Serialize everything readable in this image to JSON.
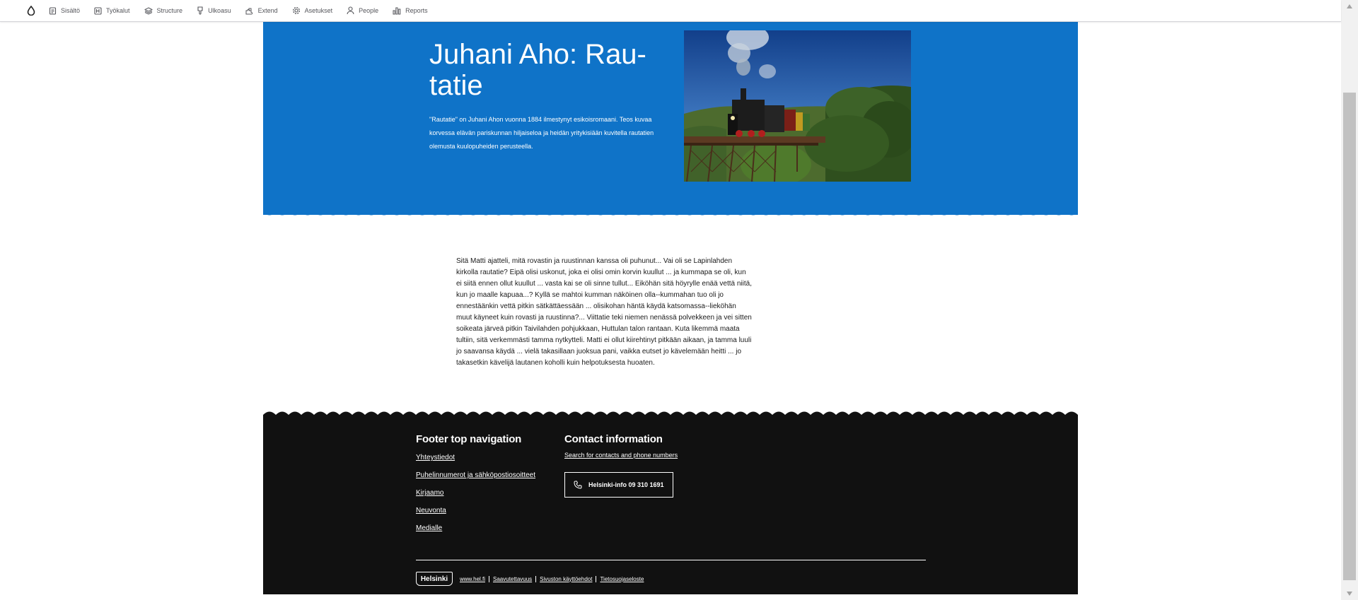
{
  "toolbar": {
    "home_icon": "drop-icon",
    "items": [
      {
        "label": "Sisältö",
        "icon": "document-icon"
      },
      {
        "label": "Työkalut",
        "icon": "tools-icon"
      },
      {
        "label": "Structure",
        "icon": "layers-icon"
      },
      {
        "label": "Ulkoasu",
        "icon": "brush-icon"
      },
      {
        "label": "Extend",
        "icon": "puzzle-icon"
      },
      {
        "label": "Asetukset",
        "icon": "gear-icon"
      },
      {
        "label": "People",
        "icon": "person-icon"
      },
      {
        "label": "Reports",
        "icon": "bar-chart-icon"
      }
    ]
  },
  "hero": {
    "title": "Juhani Aho: Rau-tatie",
    "lead": "\"Rautatie\" on Juhani Ahon vuonna 1884 ilmestynyt esikoisromaani. Teos kuvaa korvessa elävän pariskunnan hiljaiseloa ja heidän yritykisiään kuvitella rautatien olemusta kuulopuheiden perusteella.",
    "image_subject": "steam locomotive on a high iron bridge over forested valley"
  },
  "body": {
    "text": "Sitä Matti ajatteli, mitä rovastin ja ruustinnan kanssa oli puhunut... Vai oli se Lapinlahden kirkolla rautatie? Eipä olisi uskonut, joka ei olisi omin korvin kuullut ... ja kummapa se oli, kun ei siitä ennen ollut kuullut ... vasta kai se oli sinne tullut... Eiköhän sitä höyrylle enää vettä niitä, kun jo maalle kapuaa...? Kyllä se mahtoi kumman näköinen olla--kummahan tuo oli jo ennestäänkin vettä pitkin sätkättäessään ... olisikohan häntä käydä katsomassa--lieköhän muut käyneet kuin rovasti ja ruustinna?... Viittatie teki niemen nenässä polvekkeen ja vei sitten soikeata järveä pitkin Taivilahden pohjukkaan, Huttulan talon rantaan. Kuta likemmä maata tultiin, sitä verkemmästi tamma nytkytteli. Matti ei ollut kiirehtinyt pitkään aikaan, ja tamma luuli jo saavansa käydä ... vielä takasillaan juoksua pani, vaikka eutset jo kävelemään heitti ... jo takasetkin kävelijä lautanen koholli kuin helpotuksesta huoaten."
  },
  "footer": {
    "nav_heading": "Footer top navigation",
    "nav_links": [
      "Yhteystiedot",
      "Puhelinnumerot ja sähköpostiosoitteet",
      "Kirjaamo",
      "Neuvonta",
      "Medialle"
    ],
    "contact_heading": "Contact information",
    "contact_link": "Search for contacts and phone numbers",
    "phone_label": "Helsinki-info 09 310 1691",
    "logo_text": "Helsinki",
    "bottom_links": [
      "www.hel.fi",
      "Saavutettavuus",
      "Sivuston käyttöehdot",
      "Tietosuojaseloste"
    ]
  },
  "colors": {
    "hero_blue": "#0f73c8",
    "footer_black": "#111111",
    "toolbar_text": "#55565b"
  }
}
